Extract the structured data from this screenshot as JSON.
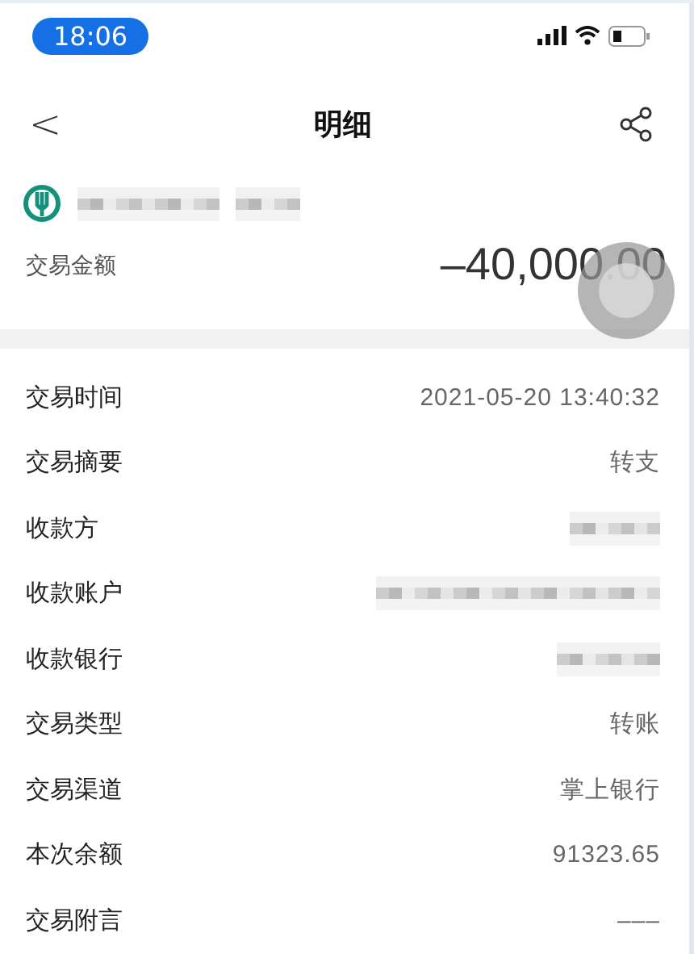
{
  "status_bar": {
    "time": "18:06"
  },
  "nav": {
    "back": "<",
    "title": "明细"
  },
  "account": {
    "masked": [
      {
        "kind": "redacted"
      },
      {
        "kind": "redacted"
      }
    ]
  },
  "amount": {
    "label": "交易金额",
    "value": "–40,000.00"
  },
  "details": [
    {
      "label": "交易时间",
      "kind": "text",
      "value": "2021-05-20 13:40:32"
    },
    {
      "label": "交易摘要",
      "kind": "text",
      "value": "转支"
    },
    {
      "label": "收款方",
      "kind": "redacted"
    },
    {
      "label": "收款账户",
      "kind": "redacted"
    },
    {
      "label": "收款银行",
      "kind": "redacted"
    },
    {
      "label": "交易类型",
      "kind": "text",
      "value": "转账"
    },
    {
      "label": "交易渠道",
      "kind": "text",
      "value": "掌上银行"
    },
    {
      "label": "本次余额",
      "kind": "text",
      "value": "91323.65"
    },
    {
      "label": "交易附言",
      "kind": "text",
      "value": "–––"
    }
  ]
}
